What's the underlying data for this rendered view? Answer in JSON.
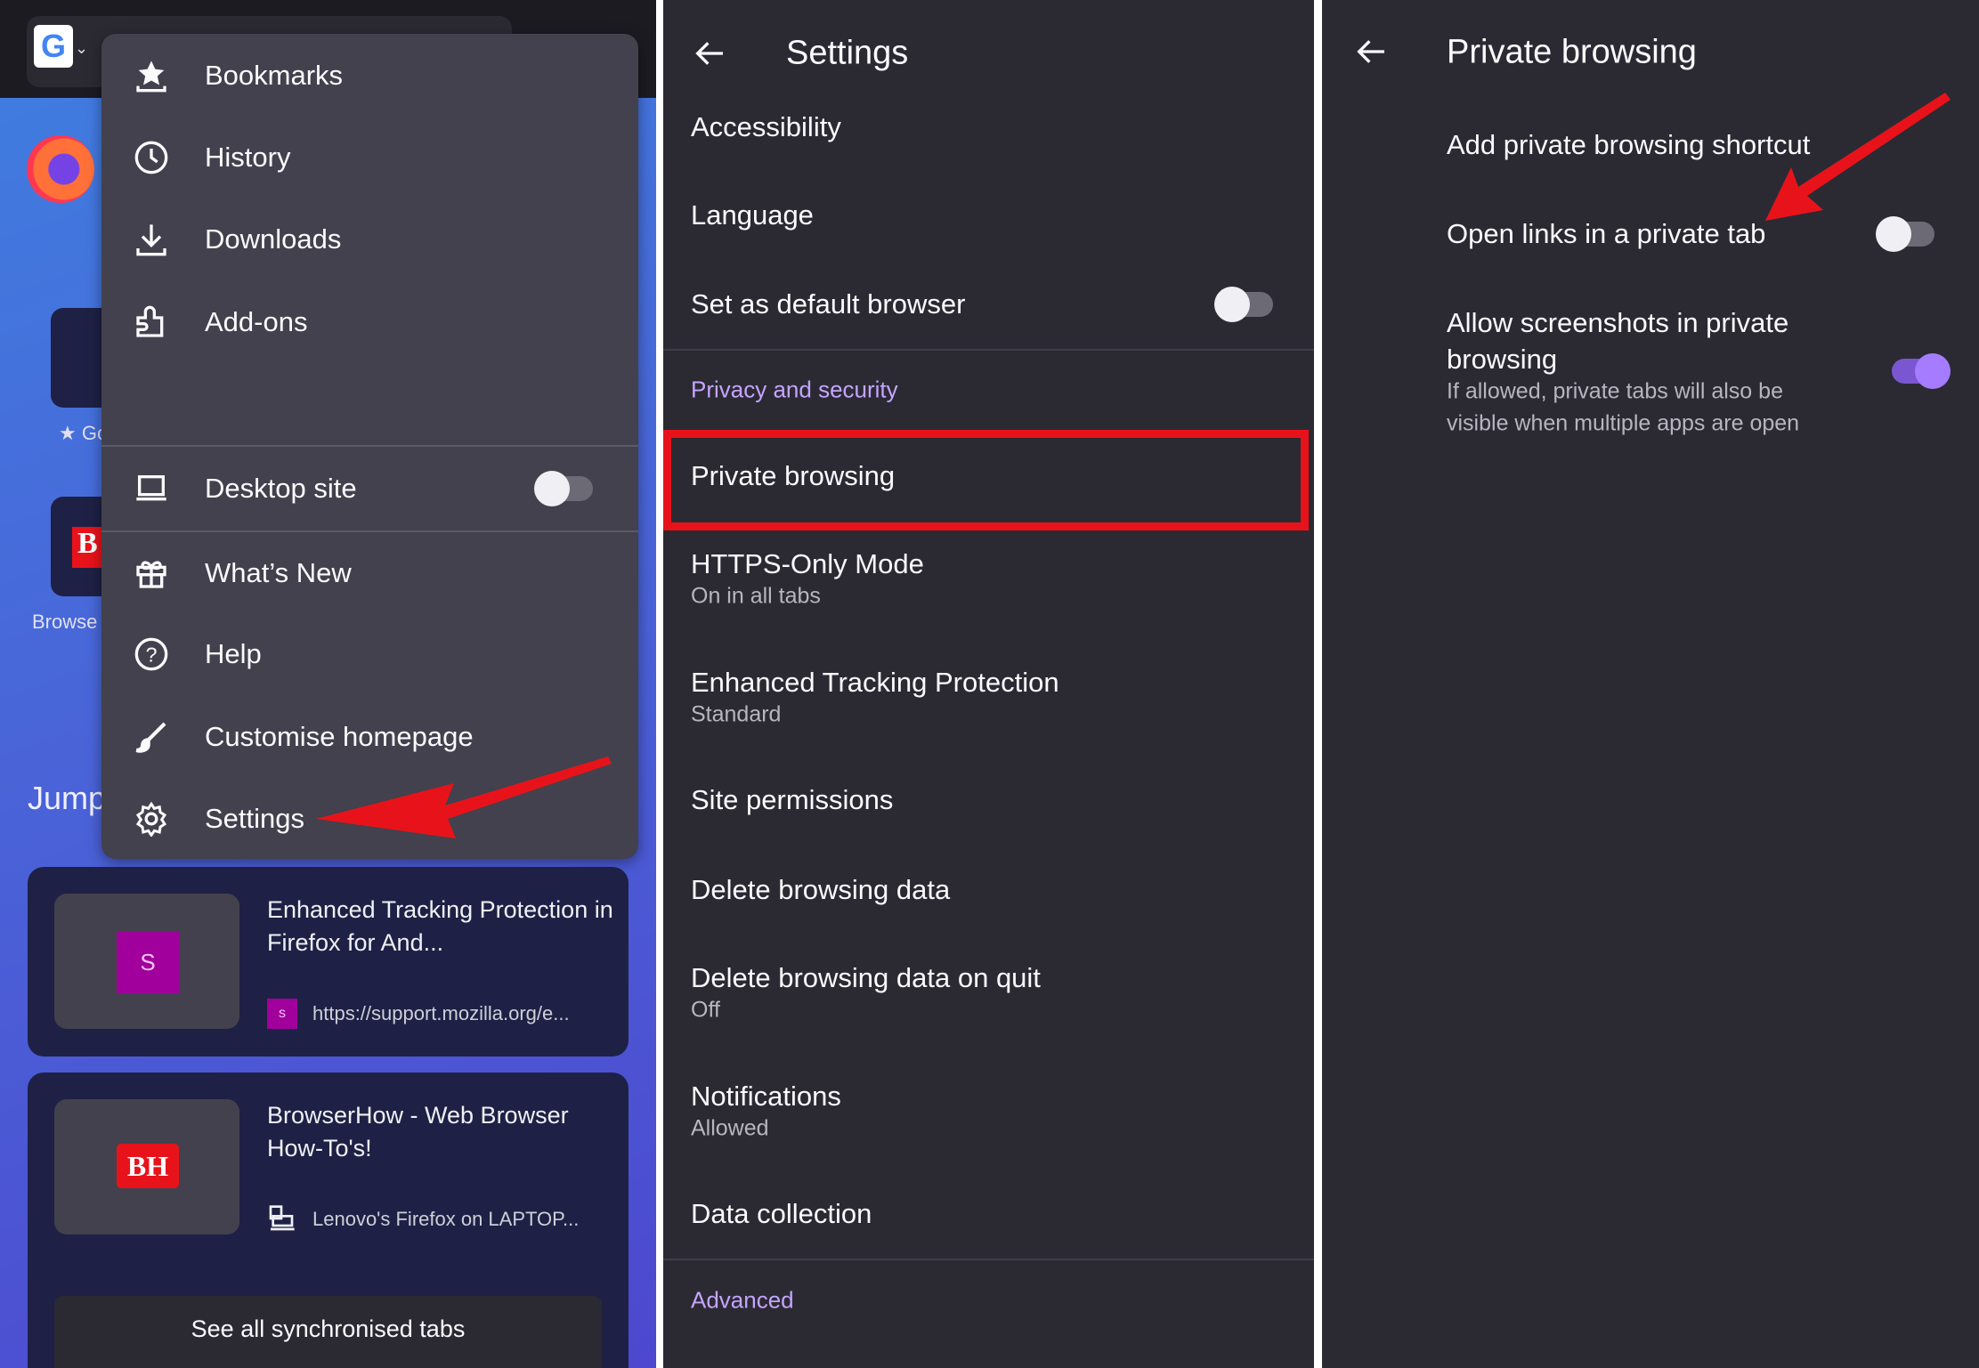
{
  "left": {
    "menu_items": [
      {
        "label": "Bookmarks",
        "icon": "bookmark-star-icon"
      },
      {
        "label": "History",
        "icon": "clock-icon"
      },
      {
        "label": "Downloads",
        "icon": "download-icon"
      },
      {
        "label": "Add-ons",
        "icon": "puzzle-icon"
      }
    ],
    "desktop_site": {
      "label": "Desktop site",
      "enabled": false
    },
    "menu_items_2": [
      {
        "label": "What’s New",
        "icon": "gift-icon"
      },
      {
        "label": "Help",
        "icon": "help-icon"
      },
      {
        "label": "Customise homepage",
        "icon": "brush-icon"
      },
      {
        "label": "Settings",
        "icon": "gear-icon"
      }
    ],
    "background": {
      "jump_label": "Jump",
      "shortcut_1": "★ Go",
      "shortcut_2": "Browse"
    },
    "cards": [
      {
        "title": "Enhanced Tracking Protection in Firefox for And...",
        "thumb_letter": "S",
        "favicon_letter": "s",
        "subtitle": "https://support.mozilla.org/e..."
      },
      {
        "title": "BrowserHow - Web Browser How-To's!",
        "thumb_letter": "BH",
        "subtitle": "Lenovo's Firefox on LAPTOP..."
      }
    ],
    "see_all": "See all synchronised tabs"
  },
  "settings": {
    "title": "Settings",
    "items_top": [
      {
        "label": "Accessibility"
      },
      {
        "label": "Language"
      }
    ],
    "default_browser": {
      "label": "Set as default browser",
      "enabled": false
    },
    "privacy_header": "Privacy and security",
    "private_browsing": "Private browsing",
    "items": [
      {
        "label": "HTTPS-Only Mode",
        "sub": "On in all tabs"
      },
      {
        "label": "Enhanced Tracking Protection",
        "sub": "Standard"
      },
      {
        "label": "Site permissions"
      },
      {
        "label": "Delete browsing data"
      },
      {
        "label": "Delete browsing data on quit",
        "sub": "Off"
      },
      {
        "label": "Notifications",
        "sub": "Allowed"
      },
      {
        "label": "Data collection"
      }
    ],
    "advanced_header": "Advanced"
  },
  "private": {
    "title": "Private browsing",
    "add_shortcut": "Add private browsing shortcut",
    "open_links": {
      "label": "Open links in a private tab",
      "enabled": false
    },
    "screenshots": {
      "label_1": "Allow screenshots in private",
      "label_2": "browsing",
      "sub_1": "If allowed, private tabs will also be",
      "sub_2": "visible when multiple apps are open",
      "enabled": true
    }
  },
  "colors": {
    "accent": "#c5a4ff",
    "annotation": "#e8131a",
    "menu_bg": "#42414d",
    "panel_bg": "#2b2a33"
  }
}
